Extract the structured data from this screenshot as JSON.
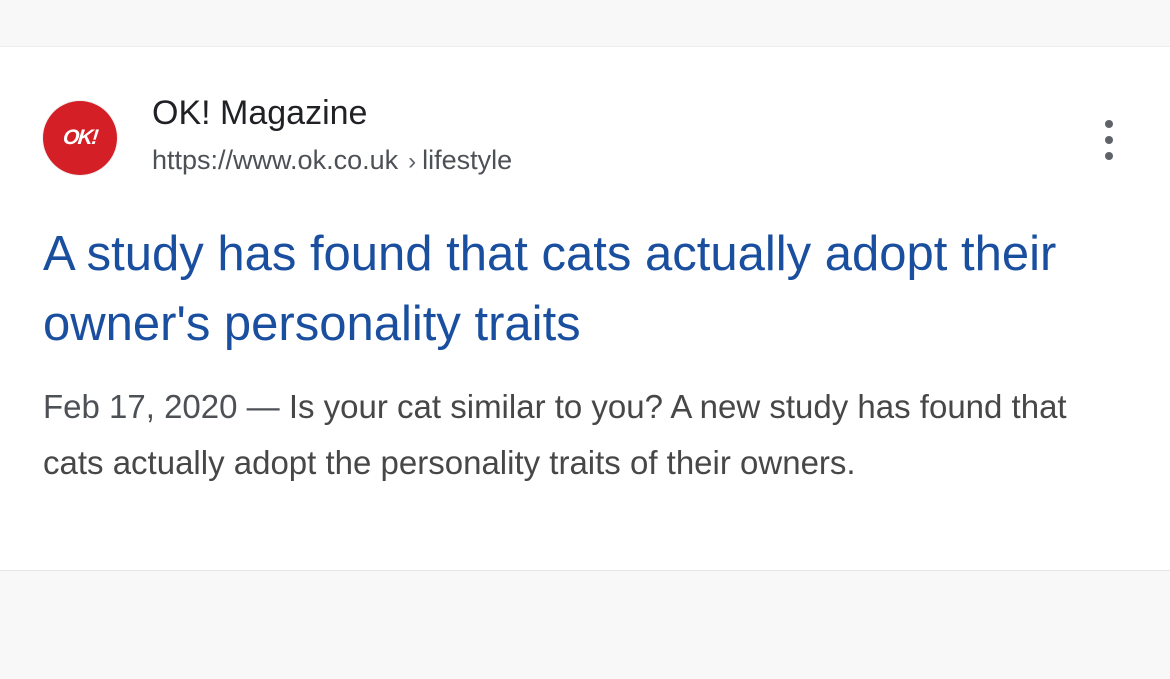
{
  "result": {
    "logo": {
      "text": "OK!",
      "icon": "ok-magazine-logo",
      "color": "#d41f26"
    },
    "site_name": "OK! Magazine",
    "url_domain": "https://www.ok.co.uk",
    "url_separator": "›",
    "url_path": "lifestyle",
    "more_icon": "more-vertical-icon",
    "title": "A study has found that cats actually adopt their owner's personality traits",
    "title_color": "#1a4fa0",
    "snippet_date": "Feb 17, 2020",
    "snippet_dash": "—",
    "snippet_text": "Is your cat similar to you? A new study has found that cats actually adopt the personality traits of their owners."
  }
}
